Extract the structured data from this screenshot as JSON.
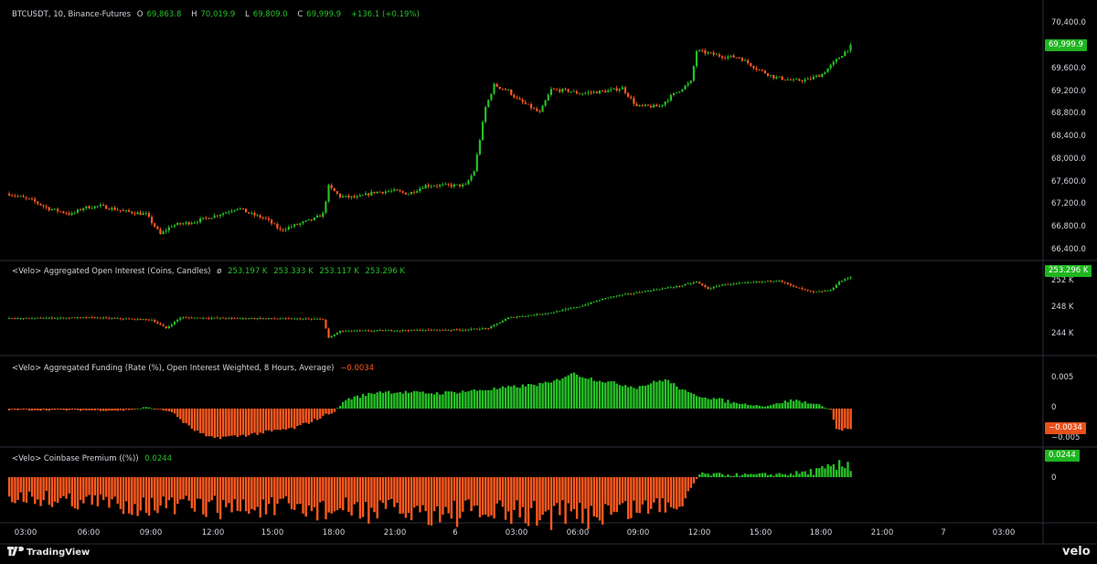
{
  "main": {
    "symbol": "BTCUSDT, 10, Binance-Futures",
    "ohlc": [
      {
        "k": "O",
        "v": "69,863.8"
      },
      {
        "k": "H",
        "v": "70,019.9"
      },
      {
        "k": "L",
        "v": "69,809.0"
      },
      {
        "k": "C",
        "v": "69,999.9"
      }
    ],
    "change": "+136.1 (+0.19%)",
    "price_tag": "69,999.9",
    "axis": [
      "70,400.0",
      "69,600.0",
      "69,200.0",
      "68,800.0",
      "68,400.0",
      "68,000.0",
      "67,600.0",
      "67,200.0",
      "66,800.0",
      "66,400.0"
    ]
  },
  "oi": {
    "title": "<Velo> Aggregated Open Interest (Coins, Candles)",
    "symbol": "ø",
    "values": [
      "253.197 K",
      "253.333 K",
      "253.117 K",
      "253.296 K"
    ],
    "tag": "253.296 K",
    "axis": [
      "252 K",
      "248 K",
      "244 K"
    ]
  },
  "funding": {
    "title": "<Velo> Aggregated Funding (Rate (%), Open Interest Weighted, 8 Hours, Average)",
    "value": "−0.0034",
    "tag": "−0.0034",
    "axis": [
      "0.005",
      "0",
      "−0.005"
    ]
  },
  "premium": {
    "title": "<Velo> Coinbase Premium ((%))",
    "value": "0.0244",
    "tag": "0.0244",
    "axis": [
      "0"
    ]
  },
  "time_axis": [
    "03:00",
    "06:00",
    "09:00",
    "12:00",
    "15:00",
    "18:00",
    "21:00",
    "6",
    "03:00",
    "06:00",
    "09:00",
    "12:00",
    "15:00",
    "18:00",
    "21:00",
    "7",
    "03:00"
  ],
  "brand": {
    "left": "TradingView",
    "right": "velo"
  },
  "colors": {
    "up": "#26c026",
    "down": "#ff5a1f",
    "background": "#000000"
  },
  "chart_data": {
    "type": "candlestick",
    "xlabel": "",
    "ylabel": "",
    "ylim": [
      66200,
      70700
    ],
    "price_keypoints": [
      [
        0,
        67350
      ],
      [
        8,
        67230
      ],
      [
        14,
        67080
      ],
      [
        22,
        66980
      ],
      [
        26,
        67100
      ],
      [
        32,
        67130
      ],
      [
        40,
        67040
      ],
      [
        48,
        66980
      ],
      [
        53,
        66620
      ],
      [
        57,
        66780
      ],
      [
        65,
        66850
      ],
      [
        75,
        67000
      ],
      [
        80,
        67100
      ],
      [
        85,
        66980
      ],
      [
        90,
        66900
      ],
      [
        95,
        66700
      ],
      [
        100,
        66780
      ],
      [
        107,
        66900
      ],
      [
        110,
        66990
      ],
      [
        112,
        67480
      ],
      [
        116,
        67300
      ],
      [
        122,
        67280
      ],
      [
        128,
        67380
      ],
      [
        135,
        67400
      ],
      [
        140,
        67350
      ],
      [
        146,
        67500
      ],
      [
        152,
        67500
      ],
      [
        160,
        67500
      ],
      [
        163,
        67760
      ],
      [
        167,
        68900
      ],
      [
        170,
        69300
      ],
      [
        175,
        69200
      ],
      [
        178,
        69050
      ],
      [
        183,
        68900
      ],
      [
        186,
        68800
      ],
      [
        190,
        69220
      ],
      [
        196,
        69200
      ],
      [
        200,
        69150
      ],
      [
        210,
        69200
      ],
      [
        215,
        69250
      ],
      [
        220,
        68920
      ],
      [
        228,
        68920
      ],
      [
        232,
        69100
      ],
      [
        236,
        69250
      ],
      [
        239,
        69360
      ],
      [
        241,
        69920
      ],
      [
        250,
        69820
      ],
      [
        256,
        69800
      ],
      [
        262,
        69600
      ],
      [
        268,
        69450
      ],
      [
        275,
        69380
      ],
      [
        280,
        69400
      ],
      [
        285,
        69500
      ],
      [
        291,
        69800
      ],
      [
        295,
        70000
      ]
    ],
    "oi_keypoints": [
      [
        0,
        247400
      ],
      [
        30,
        247500
      ],
      [
        50,
        247200
      ],
      [
        55,
        246000
      ],
      [
        60,
        247500
      ],
      [
        110,
        247300
      ],
      [
        112,
        244600
      ],
      [
        116,
        245600
      ],
      [
        160,
        245800
      ],
      [
        168,
        246000
      ],
      [
        175,
        247500
      ],
      [
        190,
        248200
      ],
      [
        200,
        249100
      ],
      [
        210,
        250400
      ],
      [
        225,
        251400
      ],
      [
        235,
        252000
      ],
      [
        241,
        252600
      ],
      [
        245,
        251600
      ],
      [
        250,
        252200
      ],
      [
        260,
        252500
      ],
      [
        270,
        252800
      ],
      [
        275,
        251900
      ],
      [
        282,
        251100
      ],
      [
        288,
        251400
      ],
      [
        291,
        252600
      ],
      [
        295,
        253300
      ]
    ],
    "funding_keypoints": [
      [
        0,
        -0.0002
      ],
      [
        40,
        -0.0003
      ],
      [
        48,
        0.0002
      ],
      [
        57,
        -0.0005
      ],
      [
        63,
        -0.003
      ],
      [
        70,
        -0.0048
      ],
      [
        80,
        -0.0045
      ],
      [
        100,
        -0.0032
      ],
      [
        114,
        -0.0005
      ],
      [
        118,
        0.0015
      ],
      [
        130,
        0.0028
      ],
      [
        150,
        0.0025
      ],
      [
        170,
        0.0032
      ],
      [
        190,
        0.0042
      ],
      [
        197,
        0.0058
      ],
      [
        205,
        0.0048
      ],
      [
        220,
        0.0035
      ],
      [
        230,
        0.0048
      ],
      [
        238,
        0.0025
      ],
      [
        255,
        0.0009
      ],
      [
        265,
        0.0004
      ],
      [
        275,
        0.0014
      ],
      [
        285,
        0.0005
      ],
      [
        288,
        -0.0002
      ],
      [
        290,
        -0.0034
      ],
      [
        295,
        -0.0034
      ]
    ],
    "premium_keypoints": [
      [
        0,
        -0.03
      ],
      [
        50,
        -0.045
      ],
      [
        100,
        -0.05
      ],
      [
        150,
        -0.055
      ],
      [
        200,
        -0.06
      ],
      [
        235,
        -0.04
      ],
      [
        240,
        -0.01
      ],
      [
        242,
        0.005
      ],
      [
        260,
        0.004
      ],
      [
        275,
        0.006
      ],
      [
        285,
        0.012
      ],
      [
        291,
        0.018
      ],
      [
        295,
        0.0244
      ]
    ]
  }
}
